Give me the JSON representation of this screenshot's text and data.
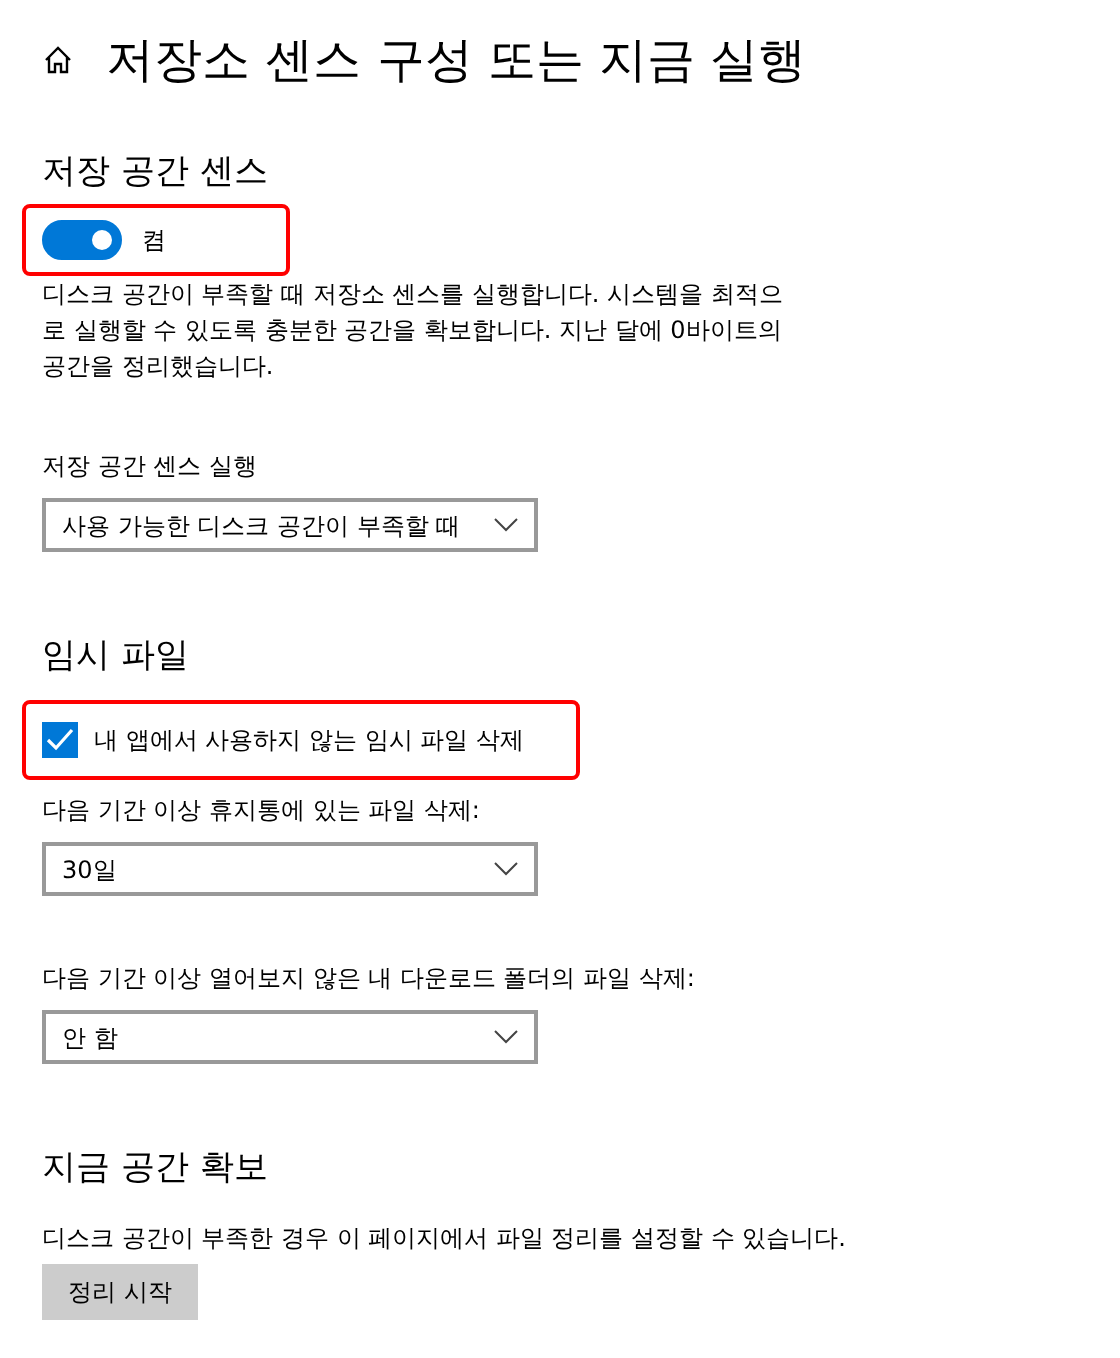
{
  "page_title": "저장소 센스 구성 또는 지금 실행",
  "sections": [
    {
      "heading": "저장 공간 센스",
      "items": [
        {
          "kind": "toggle",
          "label": "켬",
          "on": true,
          "highlighted": true
        },
        {
          "kind": "paragraph",
          "lines": [
            "디스크 공간이 부족할 때 저장소 센스를 실행합니다. 시스템을 최적으",
            "로 실행할 수 있도록 충분한 공간을 확보합니다. 지난 달에 0바이트의",
            "공간을 정리했습니다."
          ]
        },
        {
          "kind": "dropdown",
          "label": "저장 공간 센스 실행",
          "value": "사용 가능한 디스크 공간이 부족할 때"
        }
      ]
    },
    {
      "heading": "임시 파일",
      "items": [
        {
          "kind": "checkbox",
          "label": "내 앱에서 사용하지 않는 임시 파일 삭제",
          "checked": true,
          "highlighted": true
        },
        {
          "kind": "dropdown",
          "label": "다음 기간 이상 휴지통에 있는 파일 삭제:",
          "value": "30일"
        },
        {
          "kind": "dropdown",
          "label": "다음 기간 이상 열어보지 않은 내 다운로드 폴더의 파일 삭제:",
          "value": "안 함"
        }
      ]
    },
    {
      "heading": "지금 공간 확보",
      "items": [
        {
          "kind": "paragraph",
          "lines": [
            "디스크 공간이 부족한 경우 이 페이지에서 파일 정리를 설정할 수 있습니다."
          ]
        },
        {
          "kind": "button",
          "label": "정리 시작"
        }
      ]
    }
  ]
}
